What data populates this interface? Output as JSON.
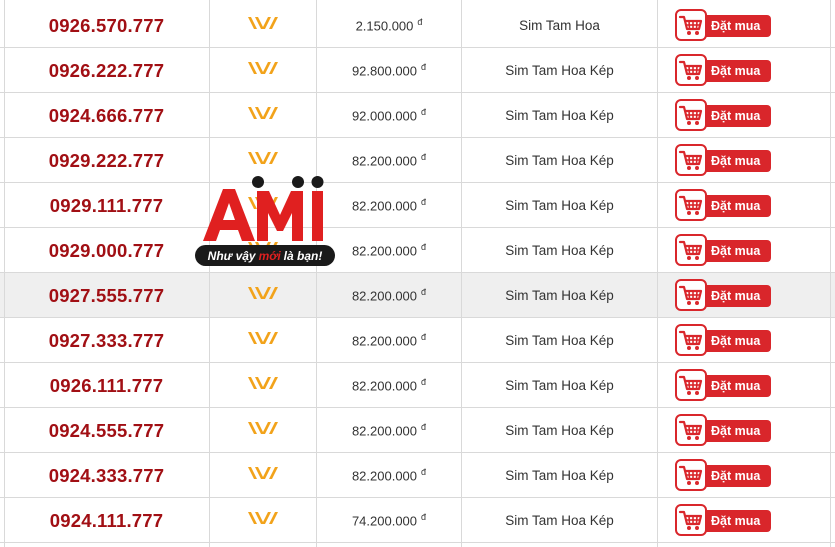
{
  "buy_label": "Đặt mua",
  "currency_symbol": "đ",
  "colors": {
    "phone": "#a10f14",
    "buy_button": "#d9262b",
    "network_logo": "#f2a31b",
    "row_highlight": "#efefef"
  },
  "icons": {
    "network": "vietnamobile-logo-icon",
    "cart": "shopping-cart-icon"
  },
  "watermark": {
    "brand": "AMI",
    "tagline_before": "Như vậy",
    "tagline_accent": "mới",
    "tagline_after": "là bạn!"
  },
  "rows": [
    {
      "number": "0926.570.777",
      "price": "2.150.000",
      "type": "Sim Tam Hoa",
      "highlight": false
    },
    {
      "number": "0926.222.777",
      "price": "92.800.000",
      "type": "Sim Tam Hoa Kép",
      "highlight": false
    },
    {
      "number": "0924.666.777",
      "price": "92.000.000",
      "type": "Sim Tam Hoa Kép",
      "highlight": false
    },
    {
      "number": "0929.222.777",
      "price": "82.200.000",
      "type": "Sim Tam Hoa Kép",
      "highlight": false
    },
    {
      "number": "0929.111.777",
      "price": "82.200.000",
      "type": "Sim Tam Hoa Kép",
      "highlight": false
    },
    {
      "number": "0929.000.777",
      "price": "82.200.000",
      "type": "Sim Tam Hoa Kép",
      "highlight": false
    },
    {
      "number": "0927.555.777",
      "price": "82.200.000",
      "type": "Sim Tam Hoa Kép",
      "highlight": true
    },
    {
      "number": "0927.333.777",
      "price": "82.200.000",
      "type": "Sim Tam Hoa Kép",
      "highlight": false
    },
    {
      "number": "0926.111.777",
      "price": "82.200.000",
      "type": "Sim Tam Hoa Kép",
      "highlight": false
    },
    {
      "number": "0924.555.777",
      "price": "82.200.000",
      "type": "Sim Tam Hoa Kép",
      "highlight": false
    },
    {
      "number": "0924.333.777",
      "price": "82.200.000",
      "type": "Sim Tam Hoa Kép",
      "highlight": false
    },
    {
      "number": "0924.111.777",
      "price": "74.200.000",
      "type": "Sim Tam Hoa Kép",
      "highlight": false
    }
  ]
}
